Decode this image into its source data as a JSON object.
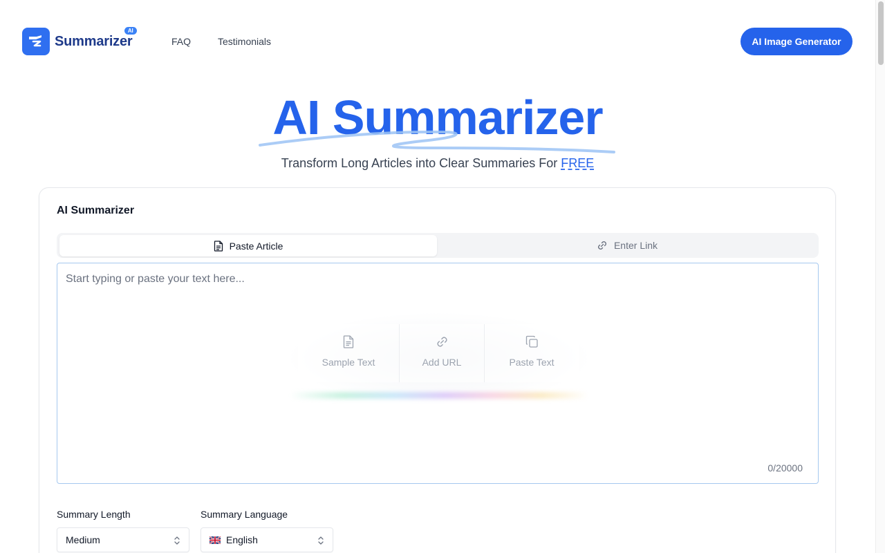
{
  "header": {
    "logo_text": "Summarizer",
    "logo_badge": "AI",
    "nav": [
      "FAQ",
      "Testimonials"
    ],
    "cta_label": "AI Image Generator"
  },
  "hero": {
    "title": "AI Summarizer",
    "subtitle_prefix": "Transform Long Articles into Clear Summaries For ",
    "subtitle_free": "FREE"
  },
  "card": {
    "title": "AI Summarizer",
    "tabs": [
      {
        "label": "Paste Article",
        "icon": "document-icon",
        "active": true
      },
      {
        "label": "Enter Link",
        "icon": "link-icon",
        "active": false
      }
    ],
    "textarea": {
      "placeholder": "Start typing or paste your text here...",
      "value": "",
      "char_count": "0/20000"
    },
    "quick_actions": [
      {
        "label": "Sample Text",
        "icon": "document-icon"
      },
      {
        "label": "Add URL",
        "icon": "link-icon"
      },
      {
        "label": "Paste Text",
        "icon": "copy-icon"
      }
    ],
    "summary_length": {
      "label": "Summary Length",
      "value": "Medium"
    },
    "summary_language": {
      "label": "Summary Language",
      "value": "English",
      "flag": "uk-flag-icon"
    }
  },
  "colors": {
    "brand": "#2563eb",
    "logo_mark": "#2f6ff0",
    "input_border": "#a5c8ef"
  }
}
